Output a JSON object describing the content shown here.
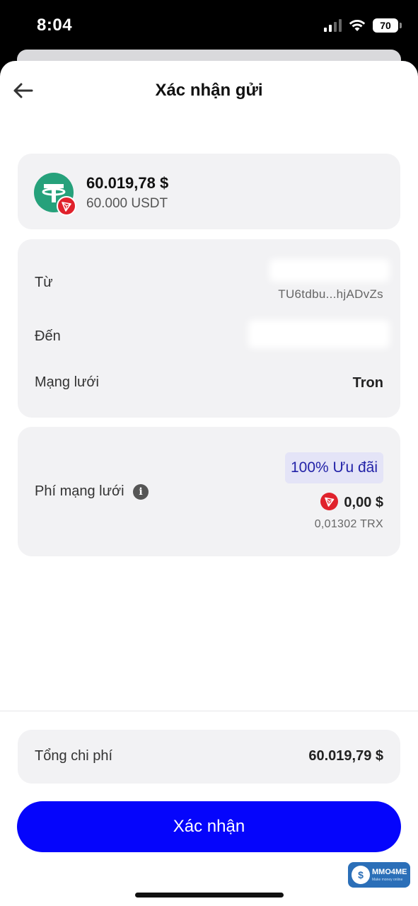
{
  "status_bar": {
    "time": "8:04",
    "battery": "70"
  },
  "header": {
    "title": "Xác nhận gửi",
    "back_icon": "arrow-left-icon"
  },
  "asset": {
    "usd_value": "60.019,78 $",
    "amount": "60.000 USDT",
    "token_icon": "tether-icon",
    "network_badge_icon": "tron-icon",
    "token_color": "#26a17b",
    "network_color": "#e0222c"
  },
  "details": {
    "from_label": "Từ",
    "from_address": "TU6tdbu...hjADvZs",
    "to_label": "Đến",
    "network_label": "Mạng lưới",
    "network_value": "Tron"
  },
  "fee": {
    "label": "Phí mạng lưới",
    "info_icon": "info-icon",
    "promo": "100% Ưu đãi",
    "usd": "0,00 $",
    "trx": "0,01302 TRX"
  },
  "total": {
    "label": "Tổng chi phí",
    "value": "60.019,79 $"
  },
  "confirm_button": {
    "label": "Xác nhận",
    "color": "#0505fc"
  },
  "watermark": {
    "text": "MMO4ME",
    "sub": "Make money online"
  }
}
